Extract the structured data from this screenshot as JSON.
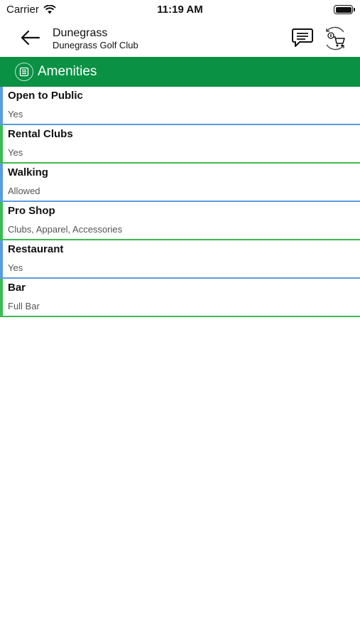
{
  "status_bar": {
    "carrier": "Carrier",
    "time": "11:19 AM"
  },
  "header": {
    "title": "Dunegrass",
    "subtitle": "Dunegrass Golf Club",
    "icons": [
      "back-arrow-icon",
      "chat-icon",
      "shopping-cart-icon"
    ]
  },
  "section": {
    "title": "Amenities",
    "icon": "list-icon"
  },
  "amenities": [
    {
      "label": "Open to Public",
      "value": "Yes"
    },
    {
      "label": "Rental Clubs",
      "value": "Yes"
    },
    {
      "label": "Walking",
      "value": "Allowed"
    },
    {
      "label": "Pro Shop",
      "value": "Clubs, Apparel, Accessories"
    },
    {
      "label": "Restaurant",
      "value": "Yes"
    },
    {
      "label": "Bar",
      "value": "Full Bar"
    }
  ],
  "colors": {
    "section_header": "#0a9144",
    "row_accent_blue": "#5b9be0",
    "row_accent_green": "#3cba54"
  }
}
